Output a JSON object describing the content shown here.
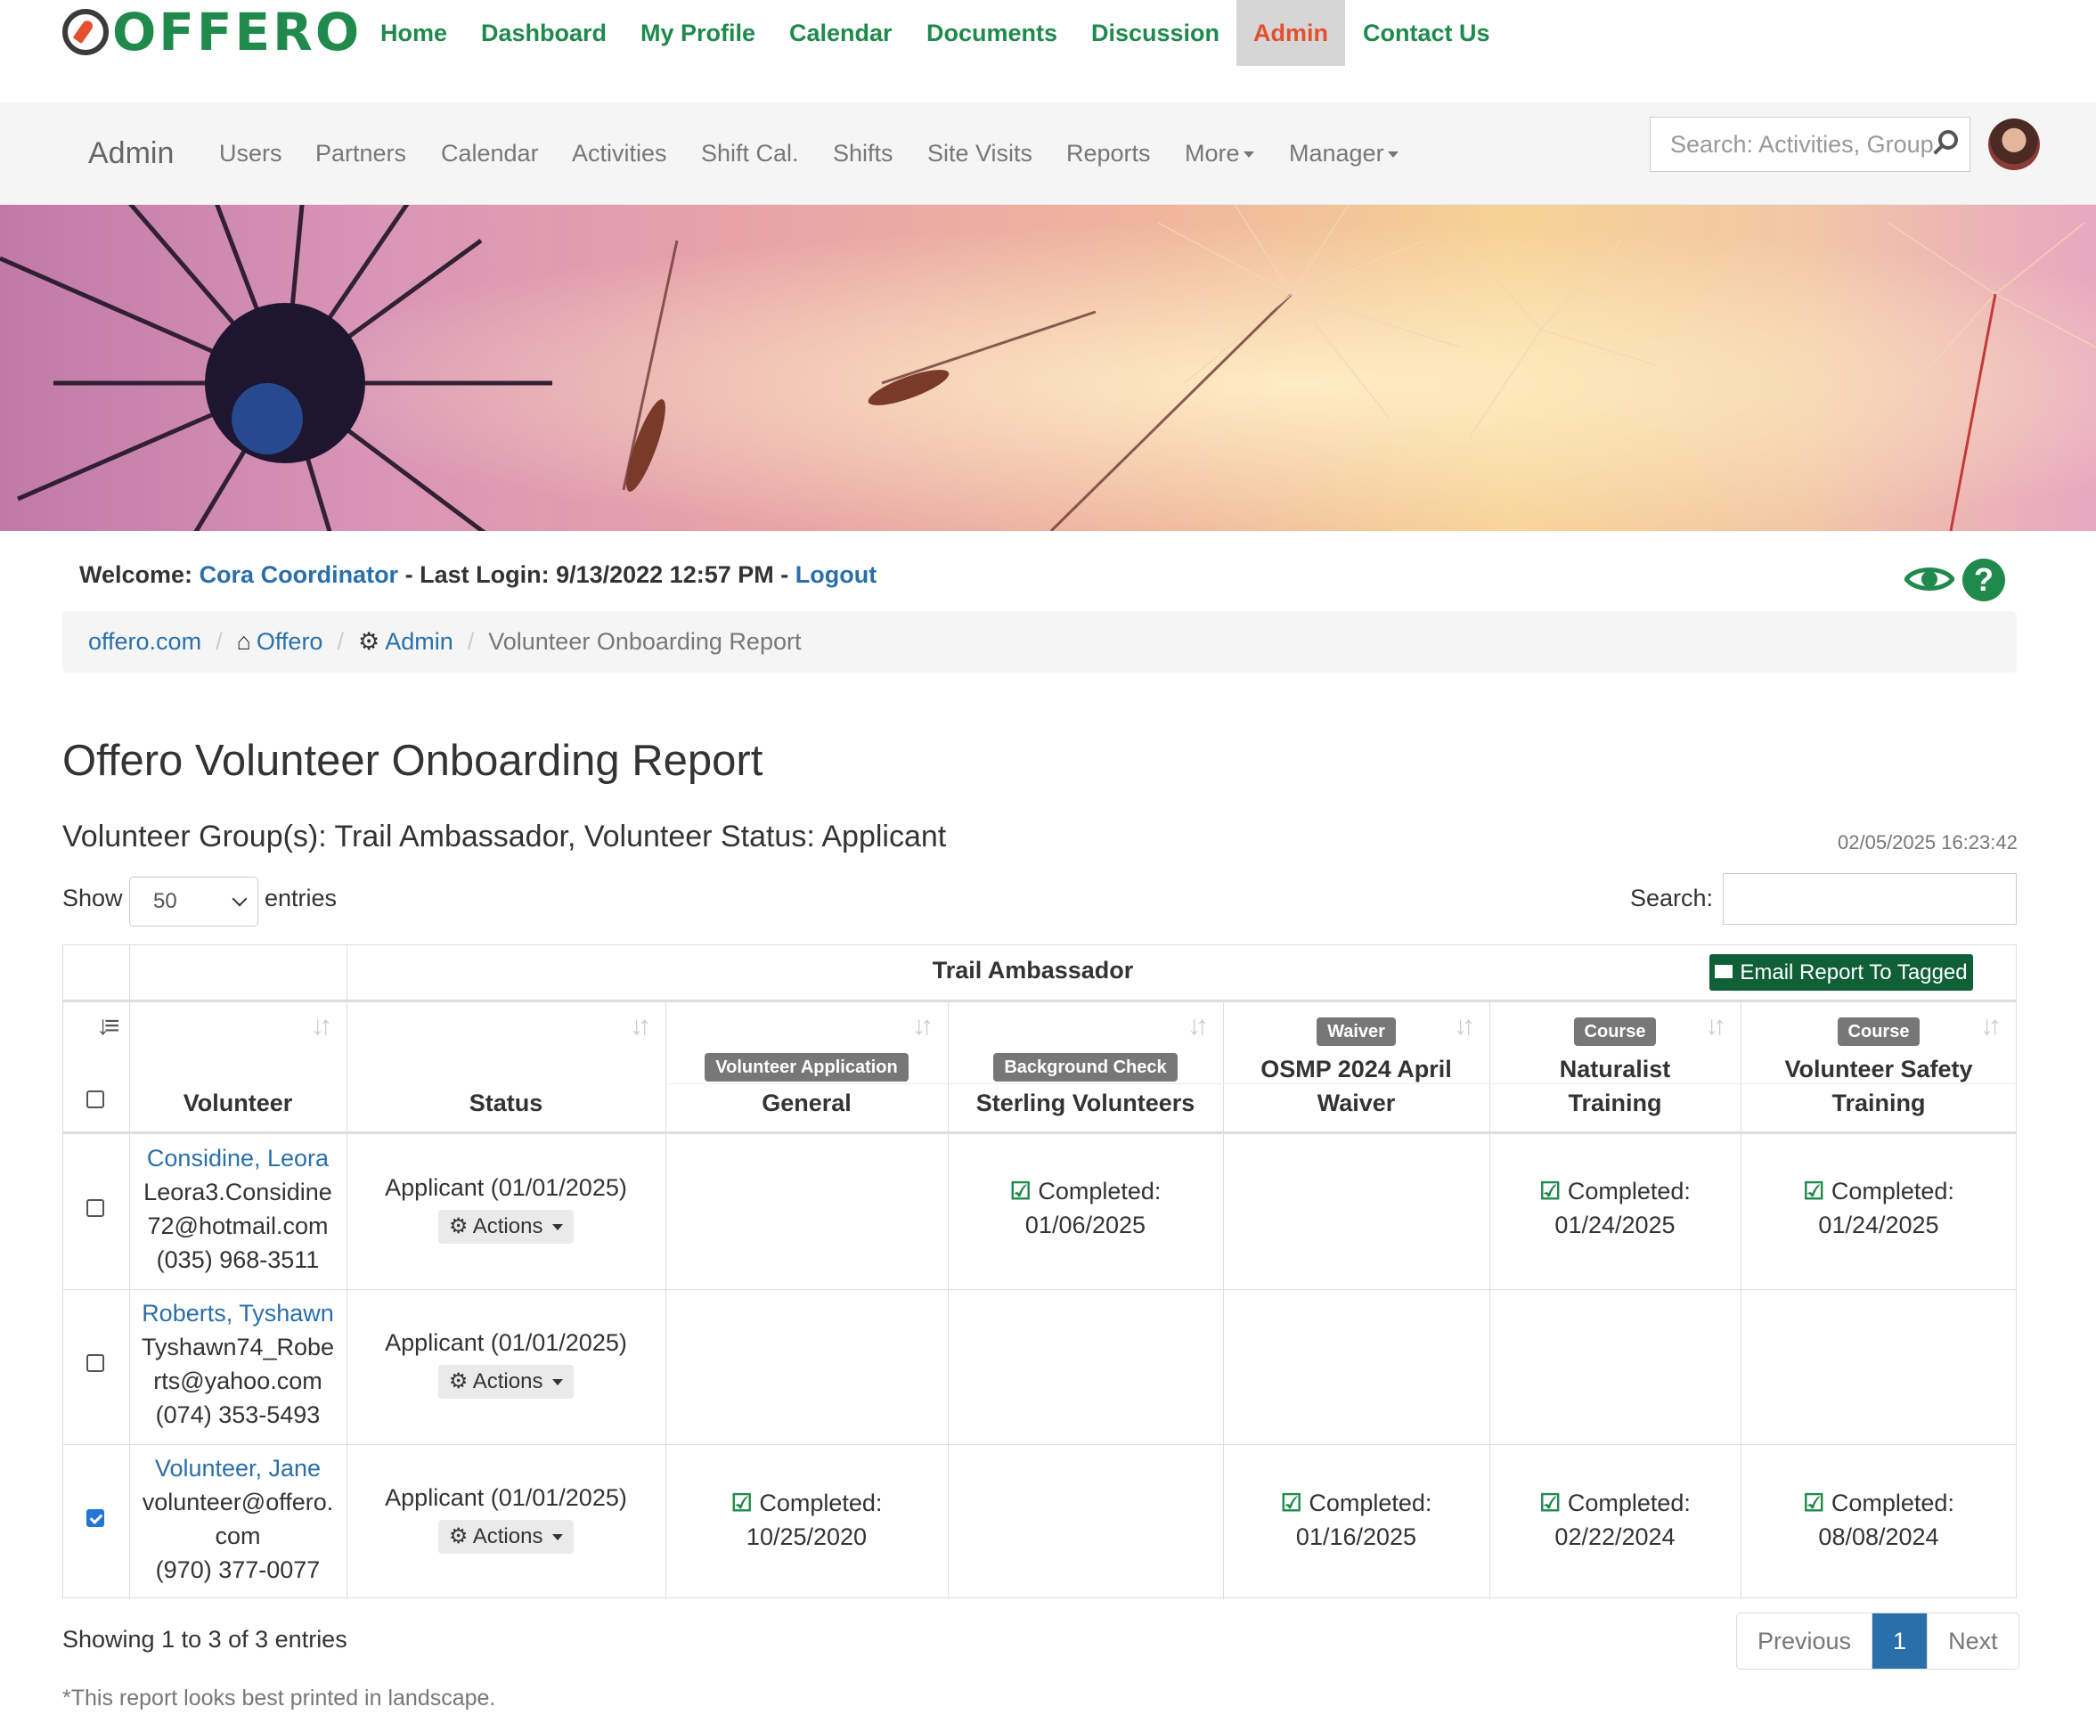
{
  "app": {
    "logo_text": "OFFERO"
  },
  "topnav": {
    "items": [
      {
        "label": "Home"
      },
      {
        "label": "Dashboard"
      },
      {
        "label": "My Profile"
      },
      {
        "label": "Calendar"
      },
      {
        "label": "Documents"
      },
      {
        "label": "Discussion"
      },
      {
        "label": "Admin",
        "active": true
      },
      {
        "label": "Contact Us"
      }
    ]
  },
  "subnav": {
    "brand": "Admin",
    "items": [
      {
        "label": "Users"
      },
      {
        "label": "Partners"
      },
      {
        "label": "Calendar"
      },
      {
        "label": "Activities"
      },
      {
        "label": "Shift Cal."
      },
      {
        "label": "Shifts"
      },
      {
        "label": "Site Visits"
      },
      {
        "label": "Reports"
      },
      {
        "label": "More"
      },
      {
        "label": "Manager"
      }
    ],
    "search_placeholder": "Search: Activities, Groups"
  },
  "welcome": {
    "prefix": "Welcome:",
    "user": "Cora Coordinator",
    "last_login": "- Last Login: 9/13/2022 12:57 PM -",
    "logout": "Logout"
  },
  "breadcrumb": [
    {
      "label": "offero.com"
    },
    {
      "label": "Offero",
      "icon": "home-icon"
    },
    {
      "label": "Admin",
      "icon": "gear-icon"
    },
    {
      "label": "Volunteer Onboarding Report"
    }
  ],
  "report": {
    "title": "Offero Volunteer Onboarding Report",
    "subtitle": "Volunteer Group(s): Trail Ambassador, Volunteer Status: Applicant",
    "timestamp": "02/05/2025 16:23:42",
    "show_label": "Show",
    "length_value": "50",
    "entries_label": "entries",
    "search_label": "Search:",
    "group_header": "Trail Ambassador",
    "email_button": "Email Report To Tagged",
    "columns": {
      "volunteer": "Volunteer",
      "status": "Status",
      "c1": {
        "badge": "Volunteer Application",
        "title": "General"
      },
      "c2": {
        "badge": "Background Check",
        "title": "Sterling Volunteers"
      },
      "c3": {
        "badge": "Waiver",
        "title1": "OSMP 2024 April",
        "title2": "Waiver"
      },
      "c4": {
        "badge": "Course",
        "title1": "Naturalist",
        "title2": "Training"
      },
      "c5": {
        "badge": "Course",
        "title1": "Volunteer Safety",
        "title2": "Training"
      }
    },
    "rows": [
      {
        "name": "Considine, Leora",
        "email1": "Leora3.Considine",
        "email2": "72@hotmail.com",
        "phone": "(035) 968-3511",
        "status": "Applicant (01/01/2025)",
        "actions": "Actions",
        "checked": false,
        "c1": "",
        "c2": "01/06/2025",
        "c3": "",
        "c4": "01/24/2025",
        "c5": "01/24/2025"
      },
      {
        "name": "Roberts, Tyshawn",
        "email1": "Tyshawn74_Robe",
        "email2": "rts@yahoo.com",
        "phone": "(074) 353-5493",
        "status": "Applicant (01/01/2025)",
        "actions": "Actions",
        "checked": false,
        "c1": "",
        "c2": "",
        "c3": "",
        "c4": "",
        "c5": ""
      },
      {
        "name": "Volunteer, Jane",
        "email1": "volunteer@offero.",
        "email2": "com",
        "phone": "(970) 377-0077",
        "status": "Applicant (01/01/2025)",
        "actions": "Actions",
        "checked": true,
        "c1": "10/25/2020",
        "c2": "",
        "c3": "01/16/2025",
        "c4": "02/22/2024",
        "c5": "08/08/2024"
      }
    ],
    "completed_label": "Completed:",
    "showing": "Showing 1 to 3 of 3 entries",
    "pager": {
      "previous": "Previous",
      "current": "1",
      "next": "Next"
    },
    "note": "*This report looks best printed in landscape."
  },
  "colors": {
    "brand_green": "#1f8a4c",
    "accent_orange": "#e4502f",
    "link_blue": "#2a6faa",
    "email_button": "#0f5f37"
  }
}
